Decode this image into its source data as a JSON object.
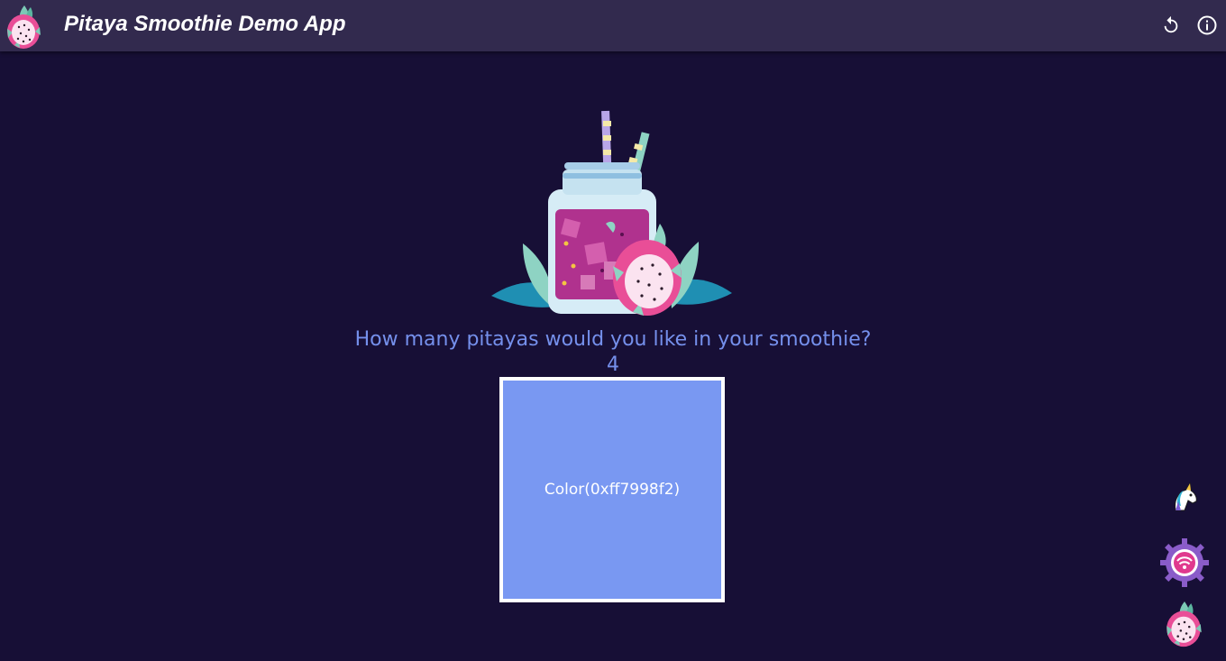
{
  "app": {
    "title": "Pitaya Smoothie Demo App"
  },
  "toolbar": {
    "actions": [
      {
        "name": "reset",
        "icon": "refresh-icon"
      },
      {
        "name": "info",
        "icon": "info-icon"
      }
    ]
  },
  "main": {
    "question": "How many pitayas would you like in your smoothie?",
    "count": "4",
    "color_box": {
      "label": "Color(0xff7998f2)",
      "color": "#7998f2"
    }
  },
  "side_actions": [
    {
      "name": "unicorn",
      "icon": "unicorn-icon"
    },
    {
      "name": "devtools",
      "icon": "gear-wifi-icon"
    },
    {
      "name": "pitaya",
      "icon": "pitaya-icon"
    }
  ],
  "colors": {
    "background": "#170f36",
    "appbar": "#322a4e",
    "accent_text": "#7590ec",
    "box": "#7998f2"
  }
}
